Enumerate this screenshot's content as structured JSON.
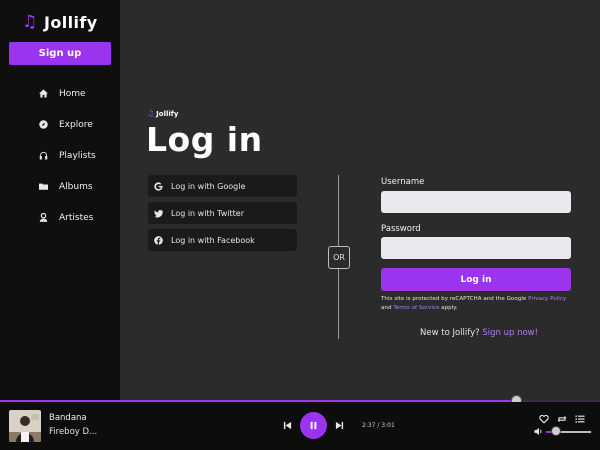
{
  "sidebar": {
    "app_name": "Jollify",
    "signup_label": "Sign up",
    "items": [
      {
        "label": "Home",
        "icon": "home-icon"
      },
      {
        "label": "Explore",
        "icon": "compass-icon"
      },
      {
        "label": "Playlists",
        "icon": "headphones-icon"
      },
      {
        "label": "Albums",
        "icon": "folder-icon"
      },
      {
        "label": "Artistes",
        "icon": "user-icon"
      }
    ]
  },
  "login": {
    "brand": "Jollify",
    "title": "Log in",
    "social": [
      {
        "label": "Log in with Google",
        "icon": "google-icon"
      },
      {
        "label": "Log in with Twitter",
        "icon": "twitter-icon"
      },
      {
        "label": "Log in with Facebook",
        "icon": "facebook-icon"
      }
    ],
    "or_label": "OR",
    "username_label": "Username",
    "username_value": "",
    "password_label": "Password",
    "password_value": "",
    "login_button": "Log in",
    "recaptcha_prefix": "This site is protected by reCAPTCHA and the Google ",
    "privacy_link": "Privacy Policy",
    "recaptcha_and": " and ",
    "terms_link": "Terms of Service",
    "recaptcha_suffix": " apply.",
    "new_to_prefix": "New to Jollify? ",
    "signup_link": "Sign up now!"
  },
  "player": {
    "track_title": "Bandana",
    "track_artist": "Fireboy D...",
    "time": "2:37 / 3:01",
    "progress": 0.862,
    "volume": 0.22
  },
  "colors": {
    "accent": "#9b34ef",
    "link": "#b47cf2",
    "sidebar_bg": "#0f0f0f",
    "main_bg": "#2b2b2b"
  }
}
